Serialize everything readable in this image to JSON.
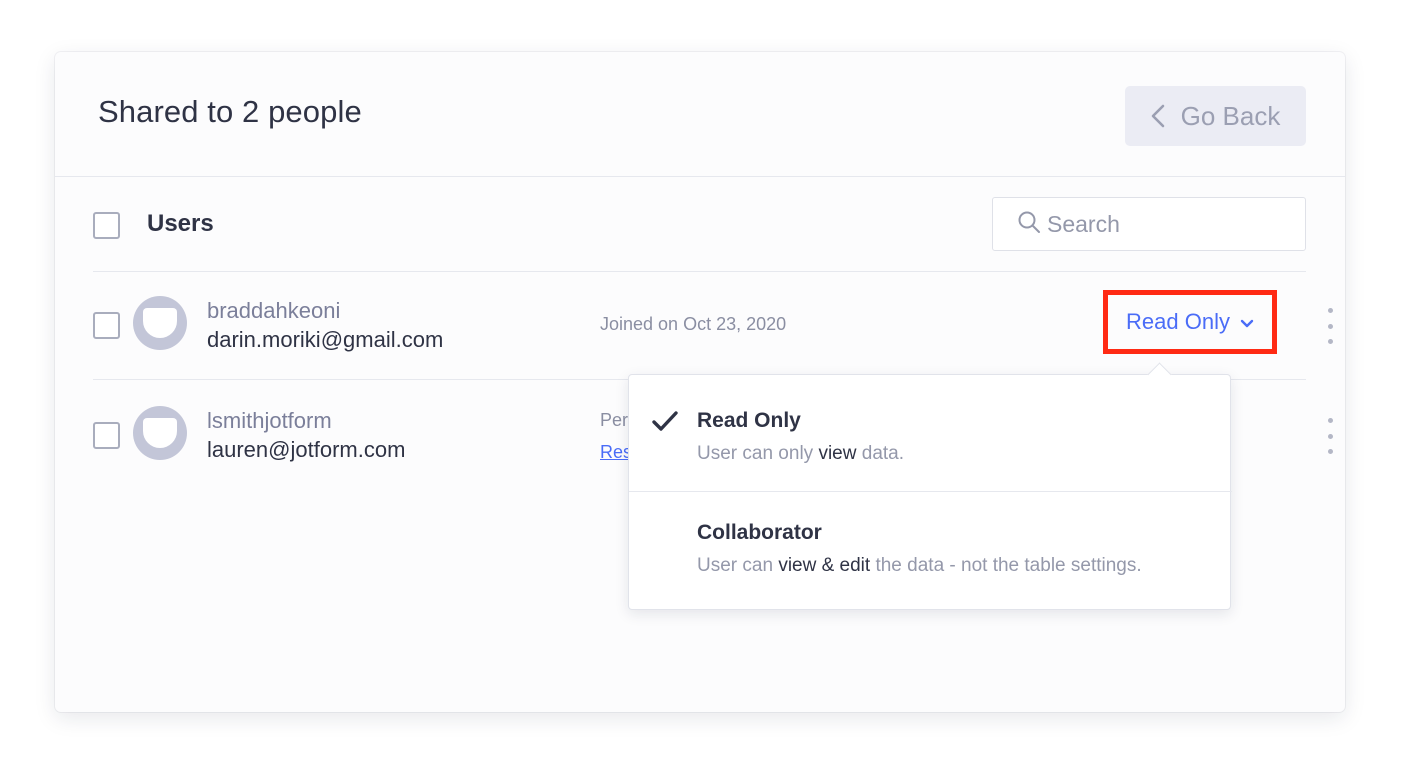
{
  "header": {
    "title": "Shared to 2 people",
    "go_back_label": "Go Back"
  },
  "users_section": {
    "label": "Users",
    "search_placeholder": "Search"
  },
  "users": [
    {
      "username": "braddahkeoni",
      "email": "darin.moriki@gmail.com",
      "joined": "Joined on Oct 23, 2020",
      "role": "Read Only"
    },
    {
      "username": "lsmithjotform",
      "email": "lauren@jotform.com",
      "status_partial": "Per",
      "link_partial": "Res"
    }
  ],
  "role_menu": {
    "options": [
      {
        "title": "Read Only",
        "selected": true,
        "desc_parts": [
          "User can only ",
          "view",
          " data."
        ]
      },
      {
        "title": "Collaborator",
        "selected": false,
        "desc_parts": [
          "User can ",
          "view & edit",
          " the data - not the table settings."
        ]
      }
    ]
  },
  "colors": {
    "accent": "#4a6cf7",
    "highlight_border": "#ff2a14",
    "text_dark": "#2f3345",
    "text_muted": "#9498aa"
  },
  "icons": [
    "chevron-left-icon",
    "search-icon",
    "chevron-down-icon",
    "more-vertical-icon",
    "checkmark-icon",
    "avatar-icon"
  ]
}
